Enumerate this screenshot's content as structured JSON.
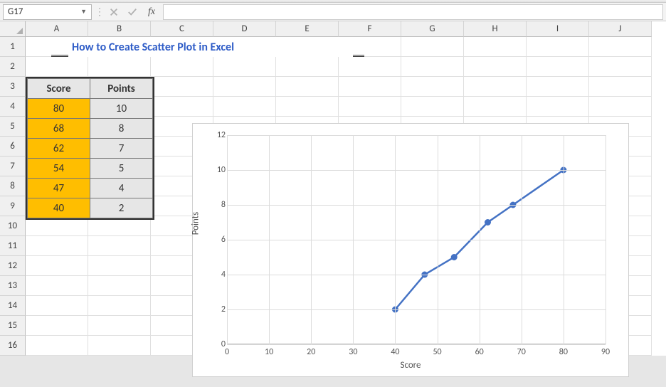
{
  "formula_bar": {
    "name_box": "G17",
    "sep": "⋮",
    "fx": "fx",
    "value": ""
  },
  "columns": [
    "A",
    "B",
    "C",
    "D",
    "E",
    "F",
    "G",
    "H",
    "I",
    "J"
  ],
  "rows": [
    "1",
    "2",
    "3",
    "4",
    "5",
    "6",
    "7",
    "8",
    "9",
    "10",
    "11",
    "12",
    "13",
    "14",
    "15",
    "16"
  ],
  "title": "How to Create Scatter Plot in Excel",
  "table": {
    "headers": {
      "score": "Score",
      "points": "Points"
    },
    "rows": [
      {
        "score": "80",
        "points": "10"
      },
      {
        "score": "68",
        "points": "8"
      },
      {
        "score": "62",
        "points": "7"
      },
      {
        "score": "54",
        "points": "5"
      },
      {
        "score": "47",
        "points": "4"
      },
      {
        "score": "40",
        "points": "2"
      }
    ]
  },
  "chart_data": {
    "type": "scatter",
    "title": "",
    "xlabel": "Score",
    "ylabel": "Points",
    "xlim": [
      0,
      90
    ],
    "ylim": [
      0,
      12
    ],
    "xticks": [
      0,
      10,
      20,
      30,
      40,
      50,
      60,
      70,
      80,
      90
    ],
    "yticks": [
      0,
      2,
      4,
      6,
      8,
      10,
      12
    ],
    "series": [
      {
        "name": "Points",
        "x": [
          40,
          47,
          54,
          62,
          68,
          80
        ],
        "y": [
          2,
          4,
          5,
          7,
          8,
          10
        ]
      }
    ]
  }
}
